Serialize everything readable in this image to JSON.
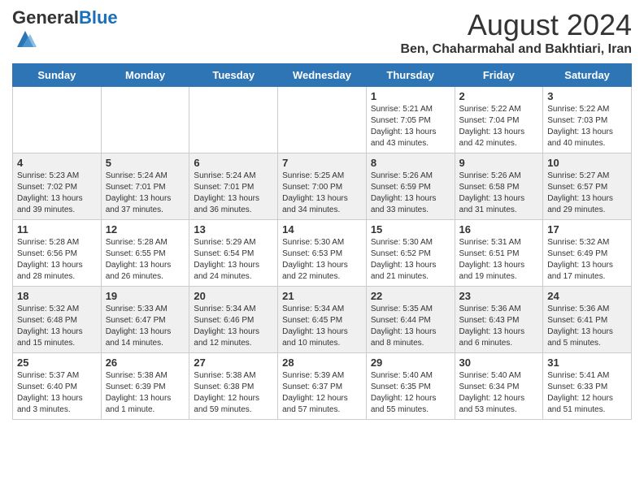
{
  "header": {
    "logo_general": "General",
    "logo_blue": "Blue",
    "month_year": "August 2024",
    "location": "Ben, Chaharmahal and Bakhtiari, Iran"
  },
  "days_of_week": [
    "Sunday",
    "Monday",
    "Tuesday",
    "Wednesday",
    "Thursday",
    "Friday",
    "Saturday"
  ],
  "weeks": [
    [
      {
        "day": "",
        "info": ""
      },
      {
        "day": "",
        "info": ""
      },
      {
        "day": "",
        "info": ""
      },
      {
        "day": "",
        "info": ""
      },
      {
        "day": "1",
        "info": "Sunrise: 5:21 AM\nSunset: 7:05 PM\nDaylight: 13 hours\nand 43 minutes."
      },
      {
        "day": "2",
        "info": "Sunrise: 5:22 AM\nSunset: 7:04 PM\nDaylight: 13 hours\nand 42 minutes."
      },
      {
        "day": "3",
        "info": "Sunrise: 5:22 AM\nSunset: 7:03 PM\nDaylight: 13 hours\nand 40 minutes."
      }
    ],
    [
      {
        "day": "4",
        "info": "Sunrise: 5:23 AM\nSunset: 7:02 PM\nDaylight: 13 hours\nand 39 minutes."
      },
      {
        "day": "5",
        "info": "Sunrise: 5:24 AM\nSunset: 7:01 PM\nDaylight: 13 hours\nand 37 minutes."
      },
      {
        "day": "6",
        "info": "Sunrise: 5:24 AM\nSunset: 7:01 PM\nDaylight: 13 hours\nand 36 minutes."
      },
      {
        "day": "7",
        "info": "Sunrise: 5:25 AM\nSunset: 7:00 PM\nDaylight: 13 hours\nand 34 minutes."
      },
      {
        "day": "8",
        "info": "Sunrise: 5:26 AM\nSunset: 6:59 PM\nDaylight: 13 hours\nand 33 minutes."
      },
      {
        "day": "9",
        "info": "Sunrise: 5:26 AM\nSunset: 6:58 PM\nDaylight: 13 hours\nand 31 minutes."
      },
      {
        "day": "10",
        "info": "Sunrise: 5:27 AM\nSunset: 6:57 PM\nDaylight: 13 hours\nand 29 minutes."
      }
    ],
    [
      {
        "day": "11",
        "info": "Sunrise: 5:28 AM\nSunset: 6:56 PM\nDaylight: 13 hours\nand 28 minutes."
      },
      {
        "day": "12",
        "info": "Sunrise: 5:28 AM\nSunset: 6:55 PM\nDaylight: 13 hours\nand 26 minutes."
      },
      {
        "day": "13",
        "info": "Sunrise: 5:29 AM\nSunset: 6:54 PM\nDaylight: 13 hours\nand 24 minutes."
      },
      {
        "day": "14",
        "info": "Sunrise: 5:30 AM\nSunset: 6:53 PM\nDaylight: 13 hours\nand 22 minutes."
      },
      {
        "day": "15",
        "info": "Sunrise: 5:30 AM\nSunset: 6:52 PM\nDaylight: 13 hours\nand 21 minutes."
      },
      {
        "day": "16",
        "info": "Sunrise: 5:31 AM\nSunset: 6:51 PM\nDaylight: 13 hours\nand 19 minutes."
      },
      {
        "day": "17",
        "info": "Sunrise: 5:32 AM\nSunset: 6:49 PM\nDaylight: 13 hours\nand 17 minutes."
      }
    ],
    [
      {
        "day": "18",
        "info": "Sunrise: 5:32 AM\nSunset: 6:48 PM\nDaylight: 13 hours\nand 15 minutes."
      },
      {
        "day": "19",
        "info": "Sunrise: 5:33 AM\nSunset: 6:47 PM\nDaylight: 13 hours\nand 14 minutes."
      },
      {
        "day": "20",
        "info": "Sunrise: 5:34 AM\nSunset: 6:46 PM\nDaylight: 13 hours\nand 12 minutes."
      },
      {
        "day": "21",
        "info": "Sunrise: 5:34 AM\nSunset: 6:45 PM\nDaylight: 13 hours\nand 10 minutes."
      },
      {
        "day": "22",
        "info": "Sunrise: 5:35 AM\nSunset: 6:44 PM\nDaylight: 13 hours\nand 8 minutes."
      },
      {
        "day": "23",
        "info": "Sunrise: 5:36 AM\nSunset: 6:43 PM\nDaylight: 13 hours\nand 6 minutes."
      },
      {
        "day": "24",
        "info": "Sunrise: 5:36 AM\nSunset: 6:41 PM\nDaylight: 13 hours\nand 5 minutes."
      }
    ],
    [
      {
        "day": "25",
        "info": "Sunrise: 5:37 AM\nSunset: 6:40 PM\nDaylight: 13 hours\nand 3 minutes."
      },
      {
        "day": "26",
        "info": "Sunrise: 5:38 AM\nSunset: 6:39 PM\nDaylight: 13 hours\nand 1 minute."
      },
      {
        "day": "27",
        "info": "Sunrise: 5:38 AM\nSunset: 6:38 PM\nDaylight: 12 hours\nand 59 minutes."
      },
      {
        "day": "28",
        "info": "Sunrise: 5:39 AM\nSunset: 6:37 PM\nDaylight: 12 hours\nand 57 minutes."
      },
      {
        "day": "29",
        "info": "Sunrise: 5:40 AM\nSunset: 6:35 PM\nDaylight: 12 hours\nand 55 minutes."
      },
      {
        "day": "30",
        "info": "Sunrise: 5:40 AM\nSunset: 6:34 PM\nDaylight: 12 hours\nand 53 minutes."
      },
      {
        "day": "31",
        "info": "Sunrise: 5:41 AM\nSunset: 6:33 PM\nDaylight: 12 hours\nand 51 minutes."
      }
    ]
  ]
}
